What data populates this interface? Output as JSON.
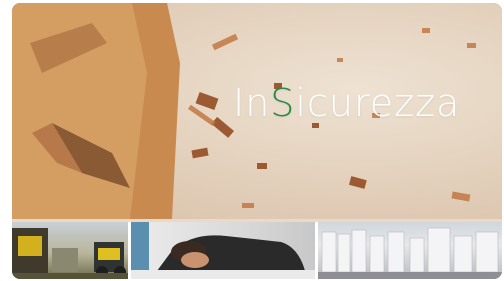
{
  "brand": {
    "text_before": "In",
    "text_accent": "S",
    "text_after": "icurezza",
    "accent_color": "#2a8a45"
  },
  "thumbnails": [
    {
      "icon": "construction-machinery-image"
    },
    {
      "icon": "tired-worker-at-desk-image"
    },
    {
      "icon": "warehouse-pallets-image"
    }
  ]
}
